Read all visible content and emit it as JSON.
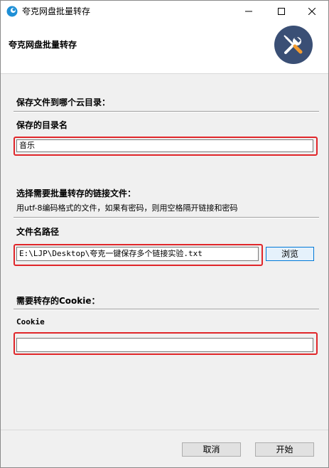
{
  "window": {
    "title": "夸克网盘批量转存"
  },
  "header": {
    "title": "夸克网盘批量转存"
  },
  "section_dir": {
    "heading": "保存文件到哪个云目录：",
    "label": "保存的目录名",
    "value": "音乐"
  },
  "section_links": {
    "heading": "选择需要批量转存的链接文件：",
    "hint": "用utf-8编码格式的文件，如果有密码，则用空格隔开链接和密码",
    "path_label": "文件名路径",
    "path_value": "E:\\LJP\\Desktop\\夸克一键保存多个链接实验.txt",
    "browse_label": "浏览"
  },
  "section_cookie": {
    "heading": "需要转存的Cookie：",
    "label": "Cookie",
    "value": ""
  },
  "footer": {
    "cancel_label": "取消",
    "start_label": "开始"
  },
  "colors": {
    "highlight": "#e0262a",
    "logo_bg": "#3a4f75",
    "accent": "#0078d7"
  },
  "icons": [
    "app-icon",
    "minimize-icon",
    "maximize-icon",
    "close-icon",
    "tools-icon"
  ]
}
